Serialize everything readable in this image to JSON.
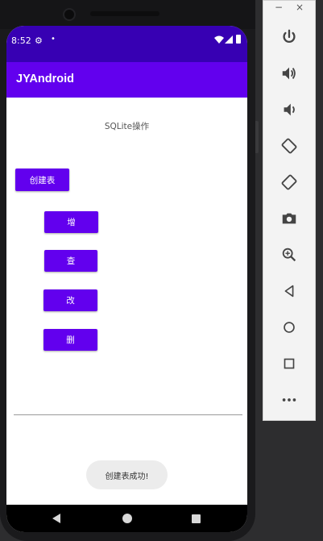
{
  "statusbar": {
    "time": "8:52",
    "settings_icon": "⚙",
    "notification_dot": "•"
  },
  "appbar": {
    "title": "JYAndroid"
  },
  "main": {
    "heading": "SQLite操作",
    "create_table_label": "创建表",
    "insert_label": "增",
    "query_label": "查",
    "update_label": "改",
    "delete_label": "删",
    "toast": "创建表成功!"
  },
  "emulator_panel": {
    "minimize": "−",
    "close": "×",
    "tools": [
      "power-icon",
      "volume-up-icon",
      "volume-down-icon",
      "rotate-left-icon",
      "rotate-right-icon",
      "camera-icon",
      "zoom-icon",
      "back-icon",
      "home-icon",
      "overview-icon",
      "more-icon"
    ]
  },
  "colors": {
    "primary": "#6200ee",
    "primary_dark": "#3700b3"
  }
}
